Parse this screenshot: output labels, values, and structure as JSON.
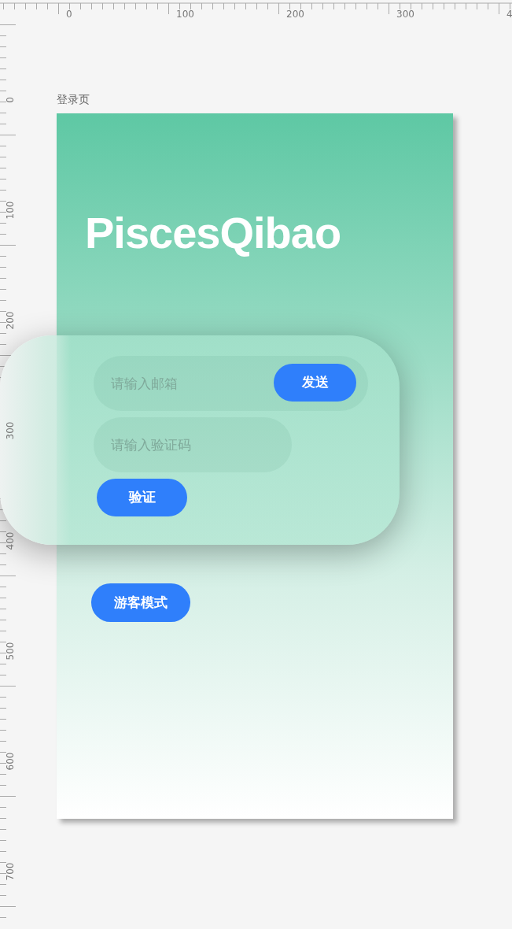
{
  "rulers": {
    "horizontal_labels": [
      "0",
      "100",
      "200",
      "300",
      "4"
    ],
    "vertical_labels": [
      "0",
      "100",
      "200",
      "300",
      "400",
      "500",
      "600",
      "700"
    ]
  },
  "artboard": {
    "label": "登录页",
    "app_title": "PiscesQibao",
    "login_card": {
      "email_field": {
        "placeholder": "请输入邮箱"
      },
      "send_button": "发送",
      "code_field": {
        "placeholder": "请输入验证码"
      },
      "verify_button": "验证"
    },
    "guest_button": "游客模式"
  }
}
